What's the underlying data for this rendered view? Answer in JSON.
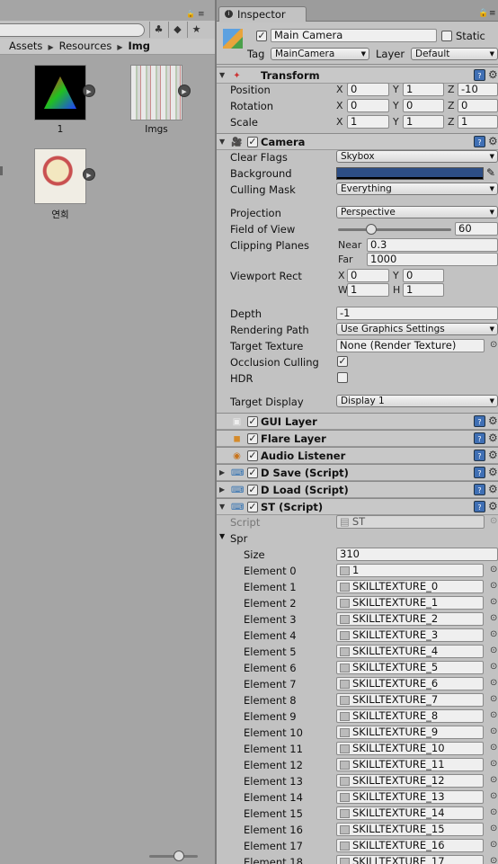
{
  "project": {
    "breadcrumb": [
      "Assets",
      "Resources",
      "Img"
    ],
    "assets": [
      {
        "name": "1"
      },
      {
        "name": "Imgs"
      },
      {
        "name": "연희"
      }
    ]
  },
  "inspector": {
    "tab_label": "Inspector",
    "object_name": "Main Camera",
    "static_label": "Static",
    "tag_label": "Tag",
    "tag_value": "MainCamera",
    "layer_label": "Layer",
    "layer_value": "Default",
    "transform": {
      "title": "Transform",
      "rows": [
        {
          "label": "Position",
          "x": "0",
          "y": "1",
          "z": "-10"
        },
        {
          "label": "Rotation",
          "x": "0",
          "y": "0",
          "z": "0"
        },
        {
          "label": "Scale",
          "x": "1",
          "y": "1",
          "z": "1"
        }
      ]
    },
    "camera": {
      "title": "Camera",
      "clear_flags_label": "Clear Flags",
      "clear_flags": "Skybox",
      "background_label": "Background",
      "background_color": "#2d4e85",
      "culling_mask_label": "Culling Mask",
      "culling_mask": "Everything",
      "projection_label": "Projection",
      "projection": "Perspective",
      "fov_label": "Field of View",
      "fov": "60",
      "fov_fraction": 0.29,
      "clipping_label": "Clipping Planes",
      "near_label": "Near",
      "near": "0.3",
      "far_label": "Far",
      "far": "1000",
      "viewport_label": "Viewport Rect",
      "vp_x": "0",
      "vp_y": "0",
      "vp_w": "1",
      "vp_h": "1",
      "depth_label": "Depth",
      "depth": "-1",
      "rendering_path_label": "Rendering Path",
      "rendering_path": "Use Graphics Settings",
      "target_texture_label": "Target Texture",
      "target_texture": "None (Render Texture)",
      "occlusion_label": "Occlusion Culling",
      "hdr_label": "HDR",
      "target_display_label": "Target Display",
      "target_display": "Display 1"
    },
    "components": [
      {
        "title": "GUI Layer"
      },
      {
        "title": "Flare Layer"
      },
      {
        "title": "Audio Listener"
      },
      {
        "title": "D Save (Script)"
      },
      {
        "title": "D Load (Script)"
      },
      {
        "title": "ST (Script)"
      }
    ],
    "st": {
      "script_label": "Script",
      "script_value": "ST",
      "array_label": "Spr",
      "size_label": "Size",
      "size": "310",
      "elements": [
        {
          "label": "Element 0",
          "value": "1"
        },
        {
          "label": "Element 1",
          "value": "SKILLTEXTURE_0"
        },
        {
          "label": "Element 2",
          "value": "SKILLTEXTURE_1"
        },
        {
          "label": "Element 3",
          "value": "SKILLTEXTURE_2"
        },
        {
          "label": "Element 4",
          "value": "SKILLTEXTURE_3"
        },
        {
          "label": "Element 5",
          "value": "SKILLTEXTURE_4"
        },
        {
          "label": "Element 6",
          "value": "SKILLTEXTURE_5"
        },
        {
          "label": "Element 7",
          "value": "SKILLTEXTURE_6"
        },
        {
          "label": "Element 8",
          "value": "SKILLTEXTURE_7"
        },
        {
          "label": "Element 9",
          "value": "SKILLTEXTURE_8"
        },
        {
          "label": "Element 10",
          "value": "SKILLTEXTURE_9"
        },
        {
          "label": "Element 11",
          "value": "SKILLTEXTURE_10"
        },
        {
          "label": "Element 12",
          "value": "SKILLTEXTURE_11"
        },
        {
          "label": "Element 13",
          "value": "SKILLTEXTURE_12"
        },
        {
          "label": "Element 14",
          "value": "SKILLTEXTURE_13"
        },
        {
          "label": "Element 15",
          "value": "SKILLTEXTURE_14"
        },
        {
          "label": "Element 16",
          "value": "SKILLTEXTURE_15"
        },
        {
          "label": "Element 17",
          "value": "SKILLTEXTURE_16"
        },
        {
          "label": "Element 18",
          "value": "SKILLTEXTURE_17"
        }
      ]
    }
  }
}
